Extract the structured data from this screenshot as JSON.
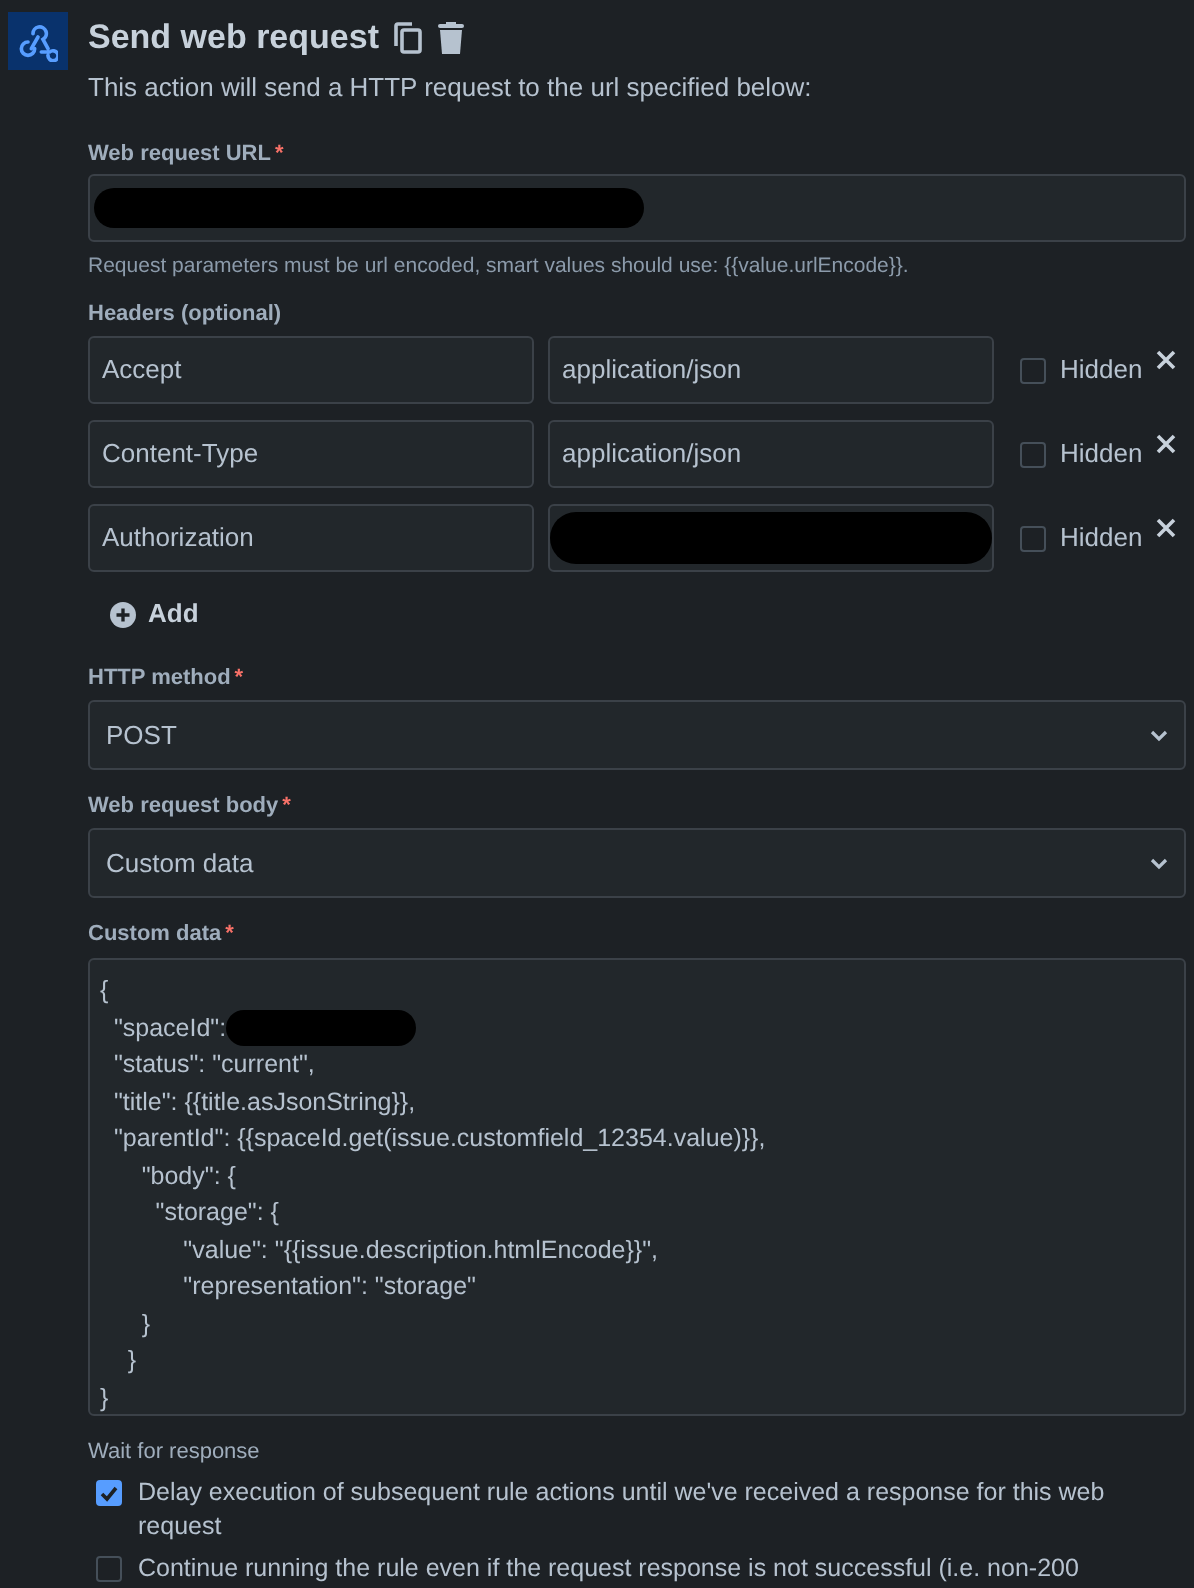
{
  "title": "Send web request",
  "description": "This action will send a HTTP request to the url specified below:",
  "required_mark": "*",
  "url_field": {
    "label": "Web request URL",
    "required": true,
    "redacted": true
  },
  "url_help": "Request parameters must be url encoded, smart values should use: {{value.urlEncode}}.",
  "headers": {
    "label": "Headers (optional)",
    "rows": [
      {
        "name": "Accept",
        "value": "application/json",
        "value_redacted": false,
        "hidden": false,
        "hidden_label": "Hidden"
      },
      {
        "name": "Content-Type",
        "value": "application/json",
        "value_redacted": false,
        "hidden": false,
        "hidden_label": "Hidden"
      },
      {
        "name": "Authorization",
        "value": "",
        "value_redacted": true,
        "hidden": false,
        "hidden_label": "Hidden"
      }
    ],
    "add_label": "Add"
  },
  "http_method": {
    "label": "HTTP method",
    "required": true,
    "value": "POST"
  },
  "body_type": {
    "label": "Web request body",
    "required": true,
    "value": "Custom data"
  },
  "custom_data": {
    "label": "Custom data",
    "required": true,
    "lines": [
      {
        "text": "{",
        "redacted": false
      },
      {
        "text": "  \"spaceId\":",
        "redacted": true
      },
      {
        "text": "  \"status\": \"current\",",
        "redacted": false
      },
      {
        "text": "  \"title\": {{title.asJsonString}},",
        "redacted": false
      },
      {
        "text": "  \"parentId\": {{spaceId.get(issue.customfield_12354.value)}},",
        "redacted": false
      },
      {
        "text": "      \"body\": {",
        "redacted": false
      },
      {
        "text": "        \"storage\": {",
        "redacted": false
      },
      {
        "text": "            \"value\": \"{{issue.description.htmlEncode}}\",",
        "redacted": false
      },
      {
        "text": "            \"representation\": \"storage\"",
        "redacted": false
      },
      {
        "text": "      }",
        "redacted": false
      },
      {
        "text": "    }",
        "redacted": false
      },
      {
        "text": "}",
        "redacted": false
      }
    ]
  },
  "wait": {
    "label": "Wait for response",
    "options": [
      {
        "label": "Delay execution of subsequent rule actions until we've received a response for this web request",
        "checked": true
      },
      {
        "label": "Continue running the rule even if the request response is not successful (i.e. non-200",
        "checked": false
      }
    ]
  }
}
